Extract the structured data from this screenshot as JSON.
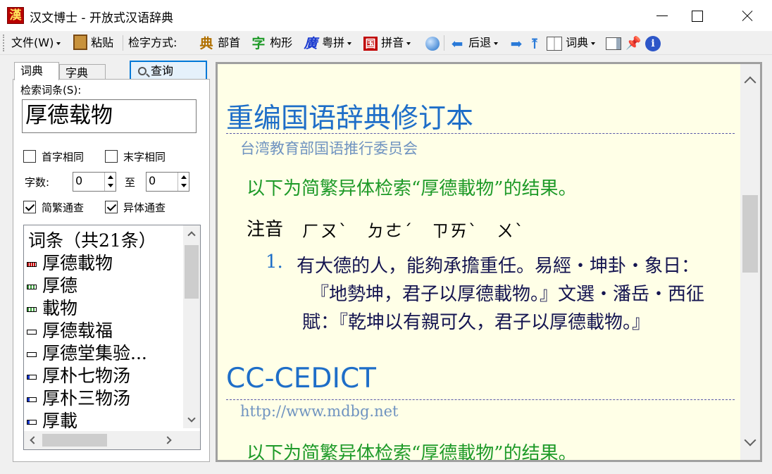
{
  "window": {
    "icon_char": "漢",
    "title": "汉文博士 - 开放式汉语辞典"
  },
  "toolbar": {
    "file": "文件(W)",
    "paste": "粘贴",
    "lookup_mode": "检字方式:",
    "radical": "部首",
    "radical_icon": "典",
    "structure": "构形",
    "structure_icon": "字",
    "cantonese": "粤拼",
    "cantonese_icon": "廣",
    "pinyin": "拼音",
    "pinyin_icon": "国",
    "back": "后退",
    "dictionary": "词典"
  },
  "left": {
    "tab_dict": "词典",
    "tab_char": "字典",
    "query_button": "查询",
    "search_label": "检索词条(S):",
    "search_value": "厚德载物",
    "first_char_same": "首字相同",
    "last_char_same": "末字相同",
    "first_char_checked": false,
    "last_char_checked": false,
    "char_count_label": "字数:",
    "count_from": "0",
    "to_label": "至",
    "count_to": "0",
    "simp_trad": "简繁通查",
    "variant": "异体通查",
    "simp_trad_checked": true,
    "variant_checked": true,
    "list_header": "词条（共21条）",
    "items": [
      "厚德載物",
      "厚德",
      "載物",
      "厚德载福",
      "厚德堂集验...",
      "厚朴七物汤",
      "厚朴三物汤",
      "厚載"
    ]
  },
  "content": {
    "dict1_title": "重编国语辞典修订本",
    "dict1_source": "台湾教育部国语推行委员会",
    "result_note": "以下为简繁异体检索“厚德載物”的结果。",
    "zhuyin_label": "注音",
    "zhuyin": "ㄏㄡˋ　ㄉㄜˊ　ㄗㄞˋ　ㄨˋ",
    "def_number": "1.",
    "def_line1": "有大德的人，能夠承擔重任。易經‧坤卦‧象日：",
    "def_line2": "『地勢坤，君子以厚德載物。』文選‧潘岳‧西征",
    "def_line3": "賦：『乾坤以有親可久，君子以厚德載物。』",
    "dict2_title": "CC-CEDICT",
    "dict2_source": "http://www.mdbg.net",
    "result_note2": "以下为简繁异体检索“厚德載物”的结果。"
  },
  "colors": {
    "title_blue": "#1e6ec8",
    "result_green": "#1e9a28",
    "content_bg": "#ffffe7",
    "accent": "#0078d7"
  }
}
